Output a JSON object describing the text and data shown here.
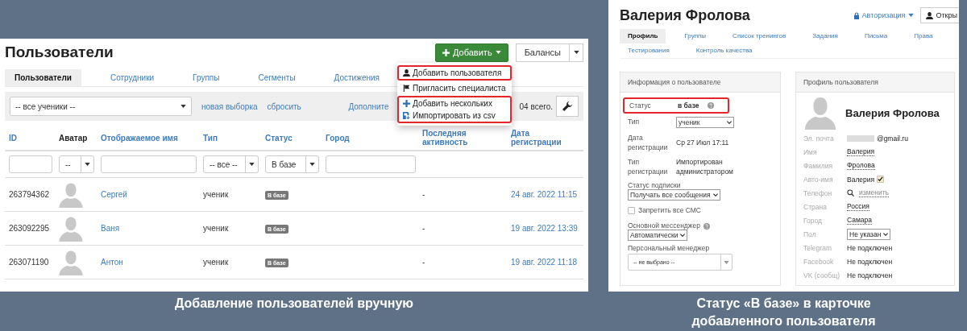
{
  "left": {
    "title": "Пользователи",
    "add_button": "Добавить",
    "balances_button": "Балансы",
    "tabs": [
      {
        "label": "Пользователи",
        "selected": true
      },
      {
        "label": "Сотрудники",
        "selected": false
      },
      {
        "label": "Группы",
        "selected": false
      },
      {
        "label": "Сегменты",
        "selected": false
      },
      {
        "label": "Достижения",
        "selected": false
      }
    ],
    "filter": {
      "select": "-- все ученики --",
      "links": [
        "новая выборка",
        "сбросить"
      ],
      "more_link": "Дополните",
      "total": "04 всего."
    },
    "add_menu": [
      {
        "highlighted": true,
        "items": [
          {
            "label": "Добавить пользователя"
          }
        ]
      },
      {
        "highlighted": false,
        "items": [
          {
            "label": "Пригласить специалиста"
          }
        ]
      },
      {
        "highlighted": true,
        "items": [
          {
            "label": "Добавить нескольких"
          },
          {
            "label": "Импортировать из csv"
          }
        ]
      }
    ],
    "table": {
      "columns": [
        {
          "label": "ID",
          "sortable": true
        },
        {
          "label": "Аватар",
          "sortable": false
        },
        {
          "label": "Отображаемое имя",
          "sortable": true
        },
        {
          "label": "Тип",
          "sortable": true
        },
        {
          "label": "Статус",
          "sortable": true
        },
        {
          "label": "Город",
          "sortable": true
        },
        {
          "label": "Последняя активность",
          "sortable": true
        },
        {
          "label": "Дата регистрации",
          "sortable": true
        }
      ],
      "filters": [
        {
          "kind": "text"
        },
        {
          "kind": "select",
          "value": "--"
        },
        {
          "kind": "text"
        },
        {
          "kind": "select",
          "value": "-- все --"
        },
        {
          "kind": "select",
          "value": "В базе"
        },
        {
          "kind": "text"
        },
        {
          "kind": "none"
        },
        {
          "kind": "none"
        }
      ],
      "rows": [
        {
          "id": "263794362",
          "name": "Сергей",
          "type": "ученик",
          "status": "В базе",
          "activity": "-",
          "date": "24 авг. 2022 11:15"
        },
        {
          "id": "263092295",
          "name": "Ваня",
          "type": "ученик",
          "status": "В базе",
          "activity": "-",
          "date": "19 авг. 2022 13:39"
        },
        {
          "id": "263071190",
          "name": "Антон",
          "type": "ученик",
          "status": "В базе",
          "activity": "-",
          "date": "19 авг. 2022 11:18"
        }
      ]
    }
  },
  "right": {
    "title": "Валерия Фролова",
    "auth_link": "Авторизация",
    "open_button": "Откры",
    "tabs": [
      {
        "label": "Профиль",
        "selected": true
      },
      {
        "label": "Группы",
        "selected": false
      },
      {
        "label": "Список тренингов",
        "selected": false
      },
      {
        "label": "Задания",
        "selected": false
      },
      {
        "label": "Письма",
        "selected": false
      },
      {
        "label": "Права",
        "selected": false
      },
      {
        "label": "Тестирования",
        "selected": false
      },
      {
        "label": "Контроль качества",
        "selected": false
      }
    ],
    "info_card": {
      "title": "Информация о пользователе",
      "rows": [
        {
          "kind": "status",
          "label": "Статус",
          "value": "в базе",
          "highlighted": true
        },
        {
          "kind": "select",
          "label": "Тип",
          "value": "ученик"
        },
        {
          "kind": "text",
          "label": "Дата регистрации",
          "value": "Ср 27 Июл 17:11"
        },
        {
          "kind": "text",
          "label": "Тип регистрации",
          "value": "Импортирован администратором"
        },
        {
          "kind": "select_block",
          "label": "Статус подписки",
          "value": "Получать все сообщения",
          "help": false
        },
        {
          "kind": "checkbox",
          "label": "Запретить все СМС",
          "checked": false
        },
        {
          "kind": "select_block",
          "label": "Основной мессенджер",
          "value": "Автоматически",
          "help": true
        },
        {
          "kind": "combo_block",
          "label": "Персональный менеджер",
          "value": "-- не выбрано --"
        }
      ]
    },
    "profile_card": {
      "title": "Профиль пользователя",
      "name": "Валерия Фролова",
      "fields": [
        {
          "kind": "email",
          "label": "Эл. почта",
          "value": "@gmail.ru"
        },
        {
          "kind": "editable",
          "label": "Имя",
          "value": "Валерия"
        },
        {
          "kind": "editable",
          "label": "Фамилия",
          "value": "Фролова"
        },
        {
          "kind": "auto",
          "label": "Авто-имя",
          "value": "Валерия",
          "checked": true
        },
        {
          "kind": "search_link",
          "label": "Телефон",
          "value": "изменить"
        },
        {
          "kind": "editable",
          "label": "Страна",
          "value": "Россия"
        },
        {
          "kind": "editable",
          "label": "Город",
          "value": "Самара"
        },
        {
          "kind": "select",
          "label": "Пол",
          "value": "Не указан"
        },
        {
          "kind": "text",
          "label": "Telegram",
          "value": "Не подключен"
        },
        {
          "kind": "text",
          "label": "Facebook",
          "value": "Не подключен"
        },
        {
          "kind": "text",
          "label": "VK (сообщ)",
          "value": "Не подключен"
        }
      ]
    }
  },
  "captions": [
    "Добавление пользователей вручную",
    "Статус «В базе» в карточке добавленного пользователя"
  ]
}
